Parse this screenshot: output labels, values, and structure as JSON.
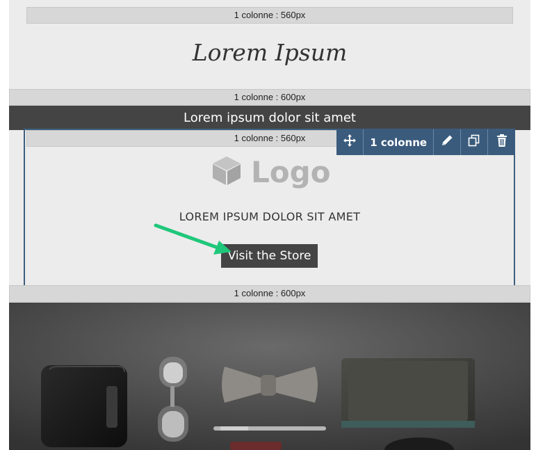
{
  "columns": {
    "top": "1 colonne : 560px",
    "banner_row": "1 colonne : 600px",
    "selected": "1 colonne : 560px",
    "image_row": "1 colonne : 600px"
  },
  "hero": {
    "title": "Lorem Ipsum"
  },
  "banner": {
    "text": "Lorem ipsum dolor sit amet"
  },
  "toolbar": {
    "label": "1 colonne",
    "icons": [
      "move-icon",
      "pencil-icon",
      "copy-icon",
      "trash-icon"
    ],
    "background": "#3a5b7c"
  },
  "logo": {
    "text": "Logo",
    "icon": "cube-icon"
  },
  "content": {
    "tagline": "LOREM IPSUM DOLOR SIT AMET",
    "button_label": "Visit the Store"
  },
  "annotation": {
    "arrow_color": "#1fc77a",
    "icon": "arrow-icon"
  },
  "photo": {
    "subject": "photo-flatlay"
  }
}
